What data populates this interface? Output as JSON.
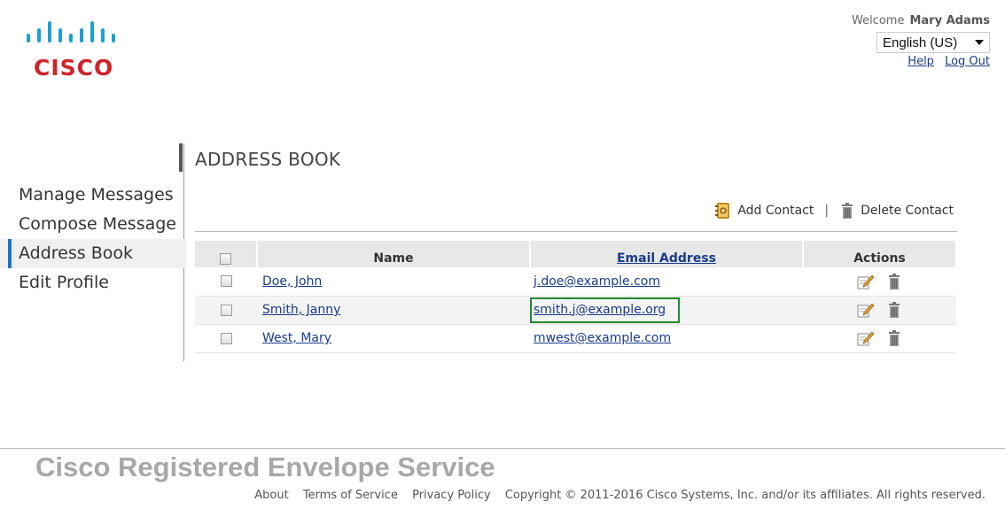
{
  "brand": {
    "logo_text": "CISCO",
    "color": "#d2232a"
  },
  "header": {
    "welcome_label": "Welcome",
    "user_name": "Mary Adams",
    "language": "English (US)",
    "help_link": "Help",
    "logout_link": "Log Out"
  },
  "sidebar": {
    "items": [
      {
        "label": "Manage Messages",
        "active": false
      },
      {
        "label": "Compose Message",
        "active": false
      },
      {
        "label": "Address Book",
        "active": true
      },
      {
        "label": "Edit Profile",
        "active": false
      }
    ]
  },
  "main": {
    "title": "ADDRESS BOOK",
    "add_contact_label": "Add Contact",
    "toolbar_separator": "|",
    "delete_contact_label": "Delete Contact",
    "table": {
      "headers": {
        "name": "Name",
        "email": "Email Address",
        "actions": "Actions"
      },
      "rows": [
        {
          "name": "Doe, John",
          "email": "j.doe@example.com"
        },
        {
          "name": "Smith, Janny",
          "email": "smith.j@example.org"
        },
        {
          "name": "West, Mary",
          "email": "mwest@example.com"
        }
      ]
    }
  },
  "footer": {
    "title": "Cisco Registered Envelope Service",
    "about": "About",
    "terms": "Terms of Service",
    "privacy": "Privacy Policy",
    "copyright": "Copyright © 2011-2016 Cisco Systems, Inc. and/or its affiliates. All rights reserved."
  }
}
